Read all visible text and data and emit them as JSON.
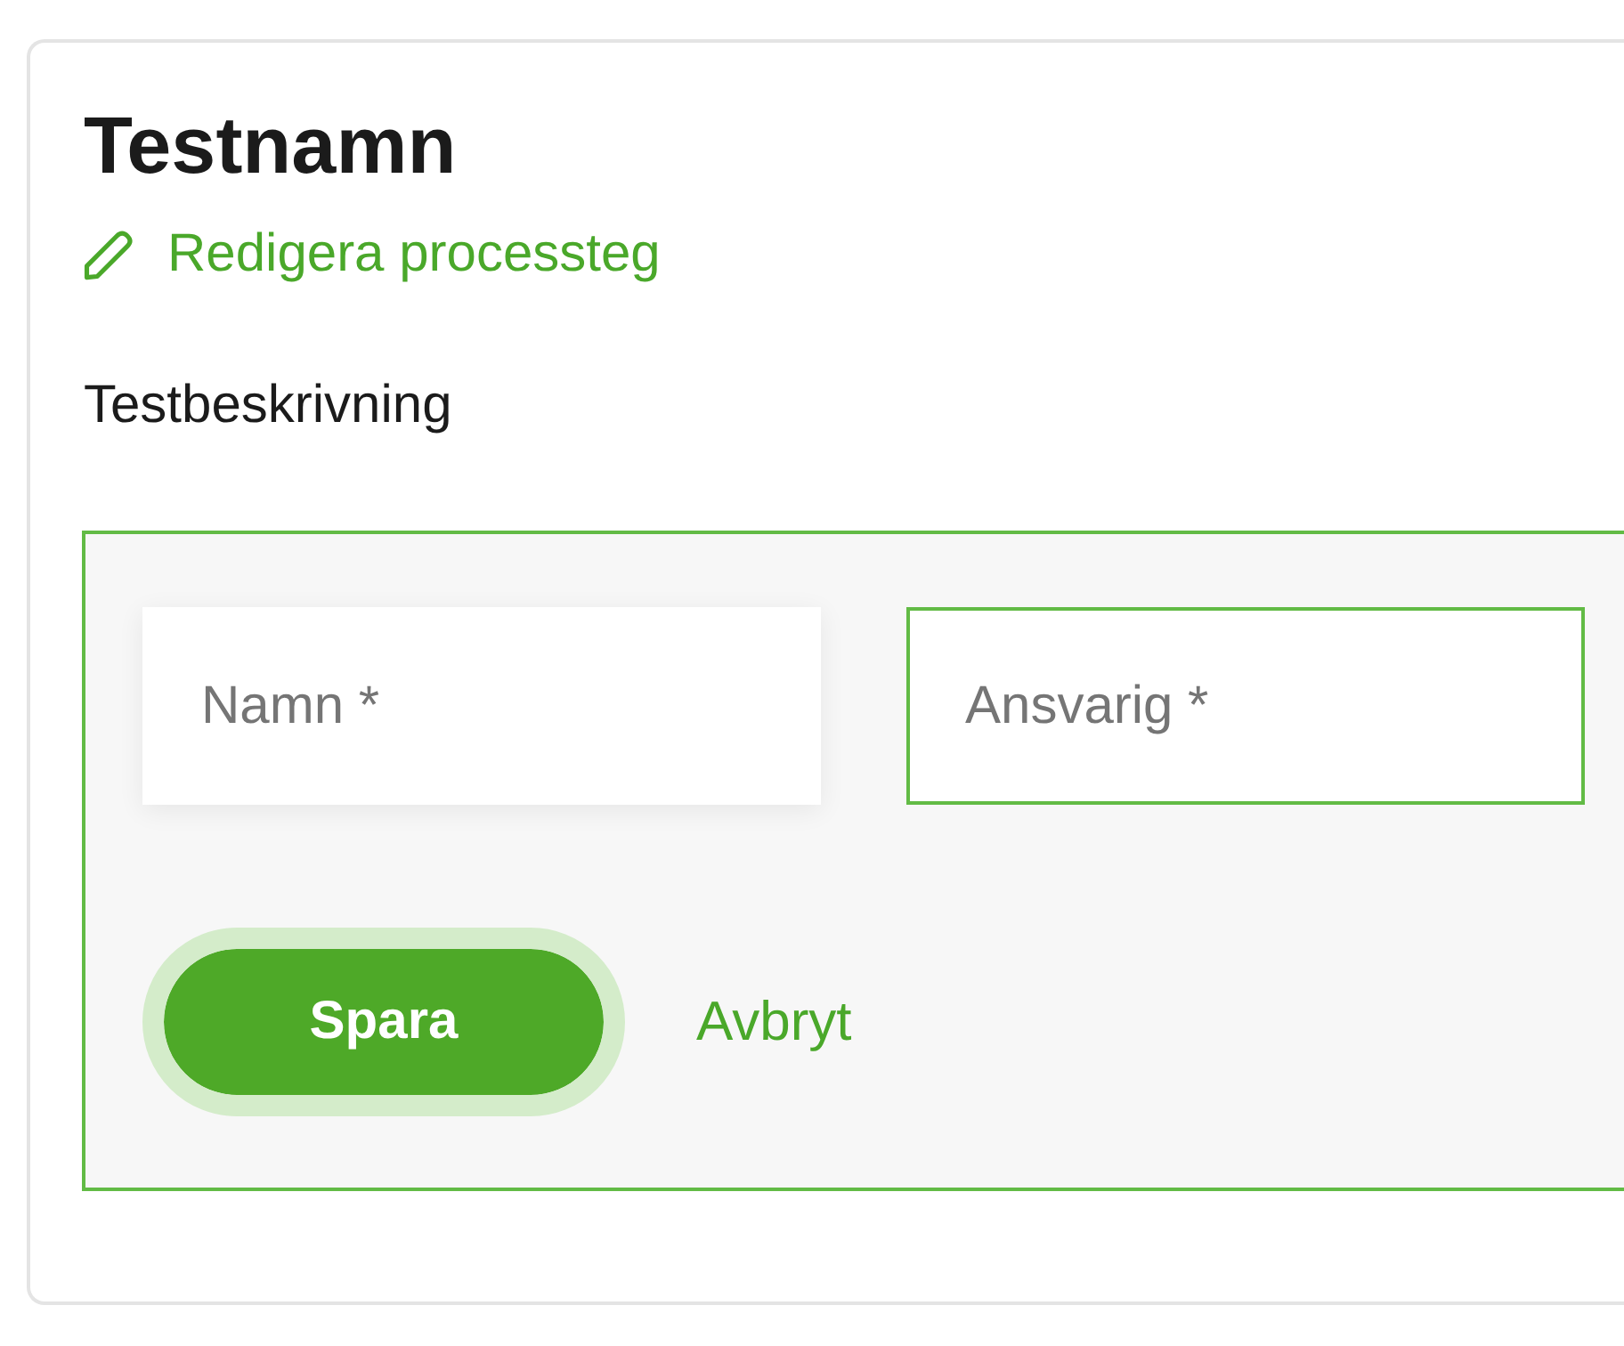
{
  "card": {
    "title": "Testnamn",
    "edit_link": {
      "label": "Redigera processteg"
    },
    "description": "Testbeskrivning",
    "form": {
      "fields": [
        {
          "placeholder": "Namn *",
          "focused": false
        },
        {
          "placeholder": "Ansvarig *",
          "focused": true
        }
      ],
      "buttons": [
        {
          "kind": "primary",
          "label": "Spara"
        },
        {
          "kind": "link",
          "label": "Avbryt"
        }
      ]
    }
  }
}
